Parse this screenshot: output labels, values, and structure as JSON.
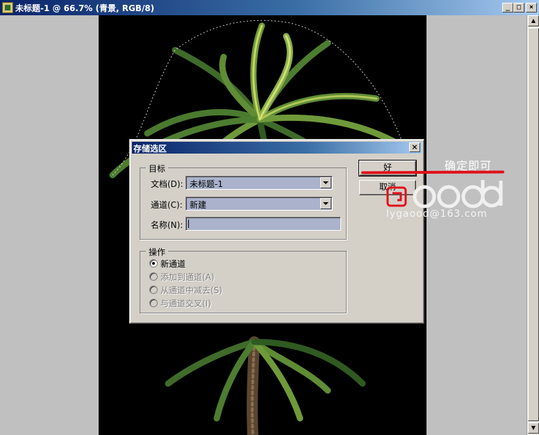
{
  "window": {
    "title": "未标题-1 @ 66.7% (青景, RGB/8)",
    "buttons": [
      "_",
      "□",
      "×"
    ]
  },
  "dialog": {
    "title": "存储选区",
    "close_label": "×",
    "target_group": {
      "legend": "目标",
      "document_label": "文档(D):",
      "document_value": "未标题-1",
      "channel_label": "通道(C):",
      "channel_value": "新建",
      "name_label": "名称(N):",
      "name_value": ""
    },
    "operation_group": {
      "legend": "操作",
      "options": [
        {
          "label": "新通道",
          "selected": true,
          "enabled": true
        },
        {
          "label": "添加到通道(A)",
          "selected": false,
          "enabled": false
        },
        {
          "label": "从通道中减去(S)",
          "selected": false,
          "enabled": false
        },
        {
          "label": "与通道交叉(I)",
          "selected": false,
          "enabled": false
        }
      ]
    },
    "ok_label": "好",
    "cancel_label": "取消"
  },
  "annotation": {
    "text": "确定即可",
    "line_color": "#e0101a"
  },
  "watermark": {
    "logo": "good",
    "text": "lygaood@163.com",
    "logo_color": "#e0101a"
  },
  "colors": {
    "title_bar": "#0a246a",
    "dialog_bg": "#d4d0c8",
    "field_bg": "#aab2cc",
    "canvas_bg": "#000000"
  }
}
